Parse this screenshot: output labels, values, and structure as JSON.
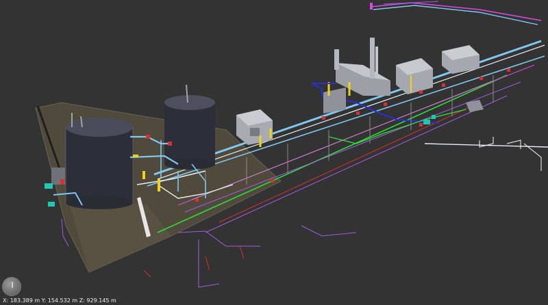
{
  "viewer": {
    "background_color": "#333333",
    "navigation_widget": "orbit-gizmo-icon"
  },
  "status_bar": {
    "coordinates": "X: 183.389 m  Y: 154.532 m  Z: 929.145 m"
  },
  "scene": {
    "objects": [
      "storage-tank-left",
      "storage-tank-right",
      "equipment-shed-small",
      "equipment-building-main",
      "stack-vent",
      "equipment-building-right",
      "pipe-rack-main",
      "gravel-pad"
    ],
    "line_colors": {
      "pipe_light_blue": "#7fc8f0",
      "pipe_white": "#e8eef2",
      "pipe_green": "#2fdc3a",
      "pipe_purple": "#a35be0",
      "pipe_magenta": "#d94be0",
      "pipe_red": "#d83030",
      "pipe_dark_blue": "#2a2fd8",
      "valve_yellow": "#f0d21a",
      "valve_teal": "#20c8b0"
    }
  }
}
